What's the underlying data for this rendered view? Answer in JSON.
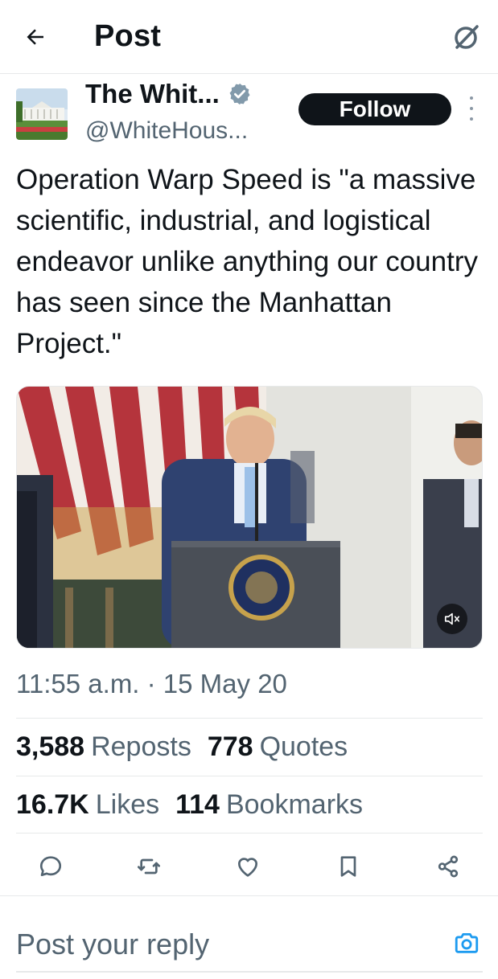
{
  "header": {
    "title": "Post",
    "back_icon": "arrow-left-icon",
    "grok_icon": "grok-icon"
  },
  "author": {
    "display_name": "The Whit...",
    "handle": "@WhiteHous...",
    "verified": true,
    "follow_label": "Follow",
    "verified_color": "#829aab"
  },
  "tweet": {
    "text": "Operation Warp Speed is \"a massive scientific, industrial, and logistical endeavor unlike anything our country has seen since the Manhattan Project.\""
  },
  "media": {
    "type": "video",
    "mute_icon": "speaker-muted-icon"
  },
  "meta": {
    "timestamp": "11:55 a.m. · 15 May 20"
  },
  "stats": {
    "reposts_count": "3,588",
    "reposts_label": "Reposts",
    "quotes_count": "778",
    "quotes_label": "Quotes",
    "likes_count": "16.7K",
    "likes_label": "Likes",
    "bookmarks_count": "114",
    "bookmarks_label": "Bookmarks"
  },
  "actions": [
    "reply-icon",
    "repost-icon",
    "like-icon",
    "bookmark-icon",
    "share-icon"
  ],
  "reply_box": {
    "placeholder": "Post your reply",
    "camera_icon": "camera-icon",
    "accent": "#1d9bf0"
  }
}
